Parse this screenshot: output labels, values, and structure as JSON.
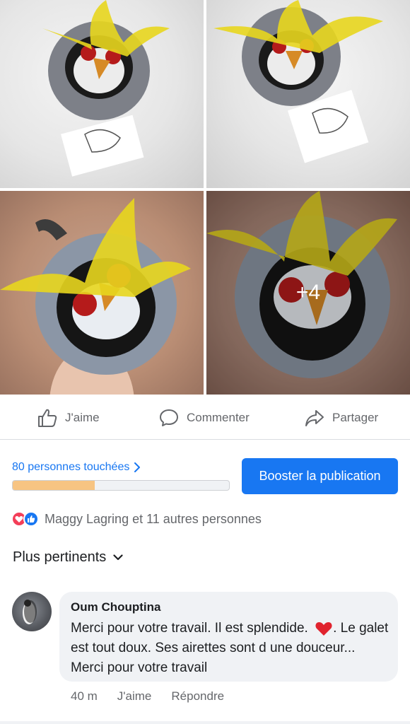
{
  "photos": {
    "more_count": "+4"
  },
  "actions": {
    "like_label": "J'aime",
    "comment_label": "Commenter",
    "share_label": "Partager"
  },
  "reach": {
    "label": "80 personnes touchées",
    "progress_fraction": 0.38,
    "boost_label": "Booster la publication"
  },
  "reactions": {
    "text": "Maggy Lagring et 11 autres personnes",
    "icons": [
      "love-icon",
      "like-icon"
    ]
  },
  "sort": {
    "label": "Plus pertinents"
  },
  "comment": {
    "author": "Oum Chouptina",
    "text_part1": "Merci pour votre travail. Il est splendide. ",
    "text_part2": ". Le galet est tout doux. Ses airettes sont d une douceur... Merci pour votre travail",
    "time": "40 m",
    "like_label": "J'aime",
    "reply_label": "Répondre"
  },
  "colors": {
    "accent": "#1877f2",
    "love": "#f33e58",
    "secondary_text": "#65676b",
    "progress_fill": "#f7c482"
  }
}
